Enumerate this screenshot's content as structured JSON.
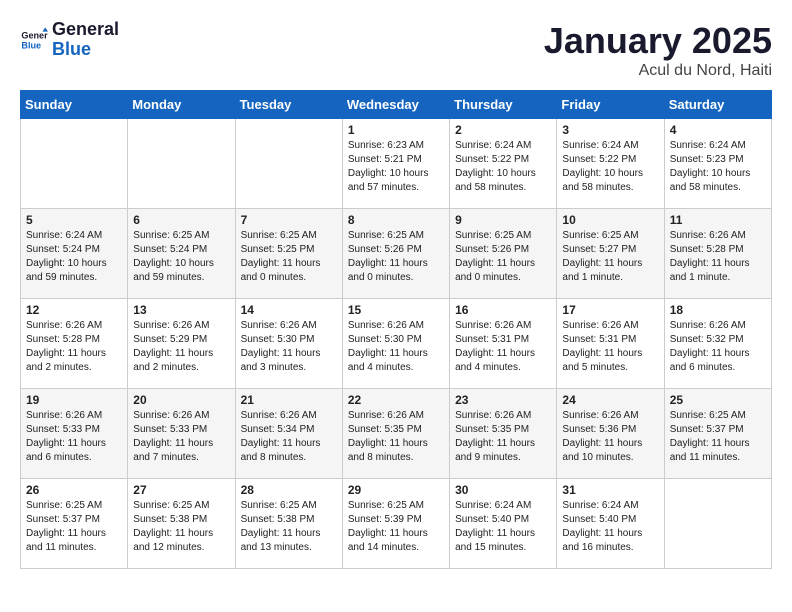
{
  "logo": {
    "line1": "General",
    "line2": "Blue"
  },
  "title": "January 2025",
  "subtitle": "Acul du Nord, Haiti",
  "days_of_week": [
    "Sunday",
    "Monday",
    "Tuesday",
    "Wednesday",
    "Thursday",
    "Friday",
    "Saturday"
  ],
  "weeks": [
    [
      {
        "day": "",
        "content": ""
      },
      {
        "day": "",
        "content": ""
      },
      {
        "day": "",
        "content": ""
      },
      {
        "day": "1",
        "content": "Sunrise: 6:23 AM\nSunset: 5:21 PM\nDaylight: 10 hours and 57 minutes."
      },
      {
        "day": "2",
        "content": "Sunrise: 6:24 AM\nSunset: 5:22 PM\nDaylight: 10 hours and 58 minutes."
      },
      {
        "day": "3",
        "content": "Sunrise: 6:24 AM\nSunset: 5:22 PM\nDaylight: 10 hours and 58 minutes."
      },
      {
        "day": "4",
        "content": "Sunrise: 6:24 AM\nSunset: 5:23 PM\nDaylight: 10 hours and 58 minutes."
      }
    ],
    [
      {
        "day": "5",
        "content": "Sunrise: 6:24 AM\nSunset: 5:24 PM\nDaylight: 10 hours and 59 minutes."
      },
      {
        "day": "6",
        "content": "Sunrise: 6:25 AM\nSunset: 5:24 PM\nDaylight: 10 hours and 59 minutes."
      },
      {
        "day": "7",
        "content": "Sunrise: 6:25 AM\nSunset: 5:25 PM\nDaylight: 11 hours and 0 minutes."
      },
      {
        "day": "8",
        "content": "Sunrise: 6:25 AM\nSunset: 5:26 PM\nDaylight: 11 hours and 0 minutes."
      },
      {
        "day": "9",
        "content": "Sunrise: 6:25 AM\nSunset: 5:26 PM\nDaylight: 11 hours and 0 minutes."
      },
      {
        "day": "10",
        "content": "Sunrise: 6:25 AM\nSunset: 5:27 PM\nDaylight: 11 hours and 1 minute."
      },
      {
        "day": "11",
        "content": "Sunrise: 6:26 AM\nSunset: 5:28 PM\nDaylight: 11 hours and 1 minute."
      }
    ],
    [
      {
        "day": "12",
        "content": "Sunrise: 6:26 AM\nSunset: 5:28 PM\nDaylight: 11 hours and 2 minutes."
      },
      {
        "day": "13",
        "content": "Sunrise: 6:26 AM\nSunset: 5:29 PM\nDaylight: 11 hours and 2 minutes."
      },
      {
        "day": "14",
        "content": "Sunrise: 6:26 AM\nSunset: 5:30 PM\nDaylight: 11 hours and 3 minutes."
      },
      {
        "day": "15",
        "content": "Sunrise: 6:26 AM\nSunset: 5:30 PM\nDaylight: 11 hours and 4 minutes."
      },
      {
        "day": "16",
        "content": "Sunrise: 6:26 AM\nSunset: 5:31 PM\nDaylight: 11 hours and 4 minutes."
      },
      {
        "day": "17",
        "content": "Sunrise: 6:26 AM\nSunset: 5:31 PM\nDaylight: 11 hours and 5 minutes."
      },
      {
        "day": "18",
        "content": "Sunrise: 6:26 AM\nSunset: 5:32 PM\nDaylight: 11 hours and 6 minutes."
      }
    ],
    [
      {
        "day": "19",
        "content": "Sunrise: 6:26 AM\nSunset: 5:33 PM\nDaylight: 11 hours and 6 minutes."
      },
      {
        "day": "20",
        "content": "Sunrise: 6:26 AM\nSunset: 5:33 PM\nDaylight: 11 hours and 7 minutes."
      },
      {
        "day": "21",
        "content": "Sunrise: 6:26 AM\nSunset: 5:34 PM\nDaylight: 11 hours and 8 minutes."
      },
      {
        "day": "22",
        "content": "Sunrise: 6:26 AM\nSunset: 5:35 PM\nDaylight: 11 hours and 8 minutes."
      },
      {
        "day": "23",
        "content": "Sunrise: 6:26 AM\nSunset: 5:35 PM\nDaylight: 11 hours and 9 minutes."
      },
      {
        "day": "24",
        "content": "Sunrise: 6:26 AM\nSunset: 5:36 PM\nDaylight: 11 hours and 10 minutes."
      },
      {
        "day": "25",
        "content": "Sunrise: 6:25 AM\nSunset: 5:37 PM\nDaylight: 11 hours and 11 minutes."
      }
    ],
    [
      {
        "day": "26",
        "content": "Sunrise: 6:25 AM\nSunset: 5:37 PM\nDaylight: 11 hours and 11 minutes."
      },
      {
        "day": "27",
        "content": "Sunrise: 6:25 AM\nSunset: 5:38 PM\nDaylight: 11 hours and 12 minutes."
      },
      {
        "day": "28",
        "content": "Sunrise: 6:25 AM\nSunset: 5:38 PM\nDaylight: 11 hours and 13 minutes."
      },
      {
        "day": "29",
        "content": "Sunrise: 6:25 AM\nSunset: 5:39 PM\nDaylight: 11 hours and 14 minutes."
      },
      {
        "day": "30",
        "content": "Sunrise: 6:24 AM\nSunset: 5:40 PM\nDaylight: 11 hours and 15 minutes."
      },
      {
        "day": "31",
        "content": "Sunrise: 6:24 AM\nSunset: 5:40 PM\nDaylight: 11 hours and 16 minutes."
      },
      {
        "day": "",
        "content": ""
      }
    ]
  ]
}
